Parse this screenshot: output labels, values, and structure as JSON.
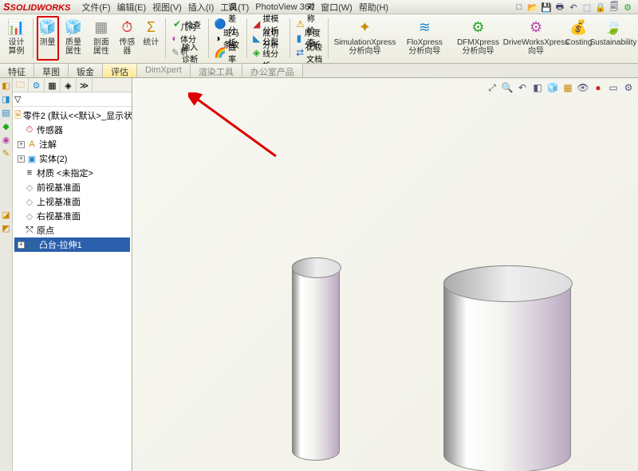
{
  "app": {
    "name": "SOLIDWORKS"
  },
  "menu": [
    "文件(F)",
    "编辑(E)",
    "视图(V)",
    "插入(I)",
    "工具(T)",
    "PhotoView 360",
    "窗口(W)",
    "帮助(H)"
  ],
  "ribbon": {
    "design_study": "设计算例",
    "measure": "测量",
    "mass_props": "质量属性",
    "section_props": "剖面属性",
    "sensor": "传感器",
    "statistics": "统计",
    "check": "检查",
    "geo_analysis": "几何体分析",
    "input_diag": "输入诊断",
    "error_analysis": "误差分析",
    "zebra": "斑马条纹",
    "curvature": "曲率",
    "draft_analysis": "拔模分析",
    "undercut": "底切分析",
    "parting_line": "分型线分析",
    "symmetry_check": "对称检查",
    "thickness": "厚度分析",
    "compare_docs": "比较文档",
    "sim_xpress": "SimulationXpress 分析向导",
    "flo_xpress": "FloXpress 分析向导",
    "dfm_xpress": "DFMXpress 分析向导",
    "driveworks": "DriveWorksXpress 向导",
    "costing": "Costing",
    "sustainability": "Sustainability"
  },
  "tabs": [
    "特征",
    "草图",
    "钣金",
    "评估",
    "DimXpert",
    "渲染工具",
    "办公室产品"
  ],
  "tree": {
    "root": "零件2  (默认<<默认>_显示状态",
    "sensors": "传感器",
    "annotations": "注解",
    "bodies": "实体(2)",
    "material": "材质 <未指定>",
    "front": "前视基准面",
    "top": "上视基准面",
    "right": "右视基准面",
    "origin": "原点",
    "feature1": "凸台-拉伸1"
  }
}
